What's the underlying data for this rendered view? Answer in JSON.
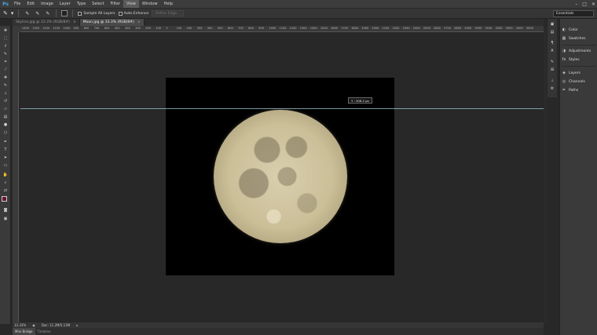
{
  "app": {
    "logo": "Ps"
  },
  "menu": [
    "File",
    "Edit",
    "Image",
    "Layer",
    "Type",
    "Select",
    "Filter",
    "View",
    "Window",
    "Help"
  ],
  "menu_active": "View",
  "window_controls": [
    "–",
    "□",
    "✕"
  ],
  "options": {
    "sample_all_layers": "Sample All Layers",
    "auto_enhance": "Auto-Enhance",
    "refine_edge": "Refine Edge...",
    "workspace": "Essentials"
  },
  "tabs": [
    {
      "label": "Skyline.jpg @ 33.3% (RGB/8#)",
      "close": "×"
    },
    {
      "label": "Moon.jpg @ 33.3% (RGB/8#)",
      "close": "×"
    }
  ],
  "ruler_ticks": [
    "1400",
    "1300",
    "1200",
    "1100",
    "1000",
    "900",
    "800",
    "700",
    "600",
    "500",
    "400",
    "300",
    "200",
    "100",
    "0",
    "100",
    "200",
    "300",
    "400",
    "500",
    "600",
    "700",
    "800",
    "900",
    "1000",
    "1100",
    "1200",
    "1300",
    "1400",
    "1500",
    "1600",
    "1700",
    "1800",
    "1900",
    "2000",
    "2100",
    "2200",
    "2300",
    "2400",
    "2500",
    "2600",
    "2700",
    "2800",
    "2900",
    "3000",
    "3100",
    "3200",
    "3300",
    "3400",
    "3500"
  ],
  "guide_readout": "Y : 306.2 px",
  "status": {
    "zoom": "33.33%",
    "doc": "Doc: 11.2M/5.13M"
  },
  "bottom_tabs": [
    "Mini Bridge",
    "Timeline"
  ],
  "panels": {
    "group1": [
      "Color",
      "Swatches"
    ],
    "group2": [
      "Adjustments",
      "Styles"
    ],
    "group3": [
      "Layers",
      "Channels",
      "Paths"
    ]
  },
  "icons": {
    "tool": "quick-selection-icon",
    "move": "move-icon",
    "marquee": "marquee-icon",
    "lasso": "lasso-icon",
    "brush": "brush-icon",
    "type": "type-icon",
    "hand": "hand-icon",
    "zoom": "zoom-icon"
  },
  "colors": {
    "foreground": "#6b1530",
    "background": "#ffffff",
    "accent": "#4aa3df"
  }
}
